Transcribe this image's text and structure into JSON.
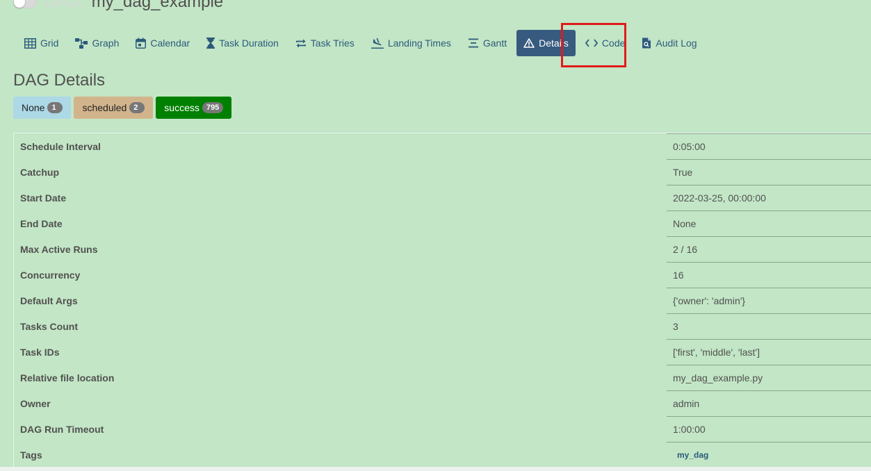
{
  "header": {
    "dag_label": "DAG:",
    "dag_id": "my_dag_example"
  },
  "nav": {
    "items": [
      {
        "label": "Grid",
        "icon": "grid-icon"
      },
      {
        "label": "Graph",
        "icon": "graph-icon"
      },
      {
        "label": "Calendar",
        "icon": "calendar-icon"
      },
      {
        "label": "Task Duration",
        "icon": "hourglass-icon"
      },
      {
        "label": "Task Tries",
        "icon": "repeat-icon"
      },
      {
        "label": "Landing Times",
        "icon": "plane-landing-icon"
      },
      {
        "label": "Gantt",
        "icon": "gantt-icon"
      },
      {
        "label": "Details",
        "icon": "warning-icon",
        "active": true
      },
      {
        "label": "Code",
        "icon": "code-icon"
      },
      {
        "label": "Audit Log",
        "icon": "file-search-icon"
      }
    ],
    "highlight_color": "#e21a1a"
  },
  "page_title": "DAG Details",
  "states": [
    {
      "label": "None",
      "count": "1",
      "color": "#add8e6"
    },
    {
      "label": "scheduled",
      "count": "2",
      "color": "#d2b48c"
    },
    {
      "label": "success",
      "count": "795",
      "color": "#008000"
    }
  ],
  "details": [
    {
      "key": "Schedule Interval",
      "value": "0:05:00"
    },
    {
      "key": "Catchup",
      "value": "True"
    },
    {
      "key": "Start Date",
      "value": "2022-03-25, 00:00:00"
    },
    {
      "key": "End Date",
      "value": "None"
    },
    {
      "key": "Max Active Runs",
      "value": "2 / 16"
    },
    {
      "key": "Concurrency",
      "value": "16"
    },
    {
      "key": "Default Args",
      "value": "{'owner': 'admin'}"
    },
    {
      "key": "Tasks Count",
      "value": "3"
    },
    {
      "key": "Task IDs",
      "value": "['first', 'middle', 'last']"
    },
    {
      "key": "Relative file location",
      "value": "my_dag_example.py"
    },
    {
      "key": "Owner",
      "value": "admin"
    },
    {
      "key": "DAG Run Timeout",
      "value": "1:00:00"
    },
    {
      "key": "Tags",
      "value": "my_dag"
    }
  ],
  "colors": {
    "background": "#c2e6c6",
    "link": "#2d5a7a",
    "active_tab": "#375a7f"
  }
}
